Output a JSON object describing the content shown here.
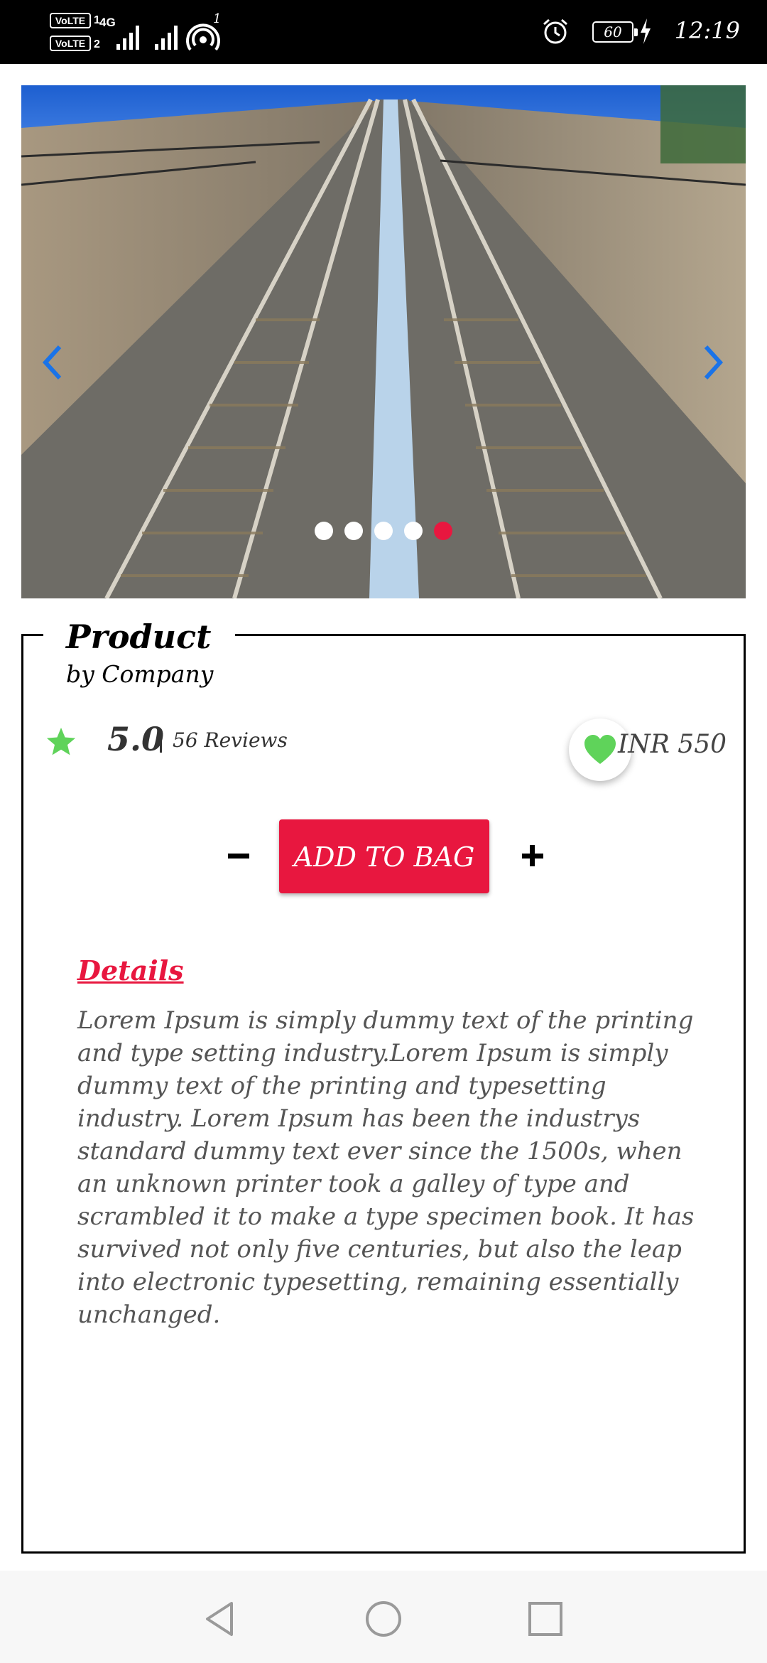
{
  "status_bar": {
    "sim1_label": "VoLTE",
    "sim1_num": "1",
    "network_type": "4G",
    "sim2_label": "VoLTE",
    "sim2_num": "2",
    "hotspot_count": "1",
    "battery_level": "60",
    "time": "12:19"
  },
  "carousel": {
    "total_slides": 5,
    "active_index": 4,
    "colors": {
      "active_dot": "#e8173f",
      "inactive_dot": "#ffffff",
      "arrow": "#1a73e8"
    }
  },
  "product": {
    "title": "Product",
    "company": "by Company",
    "rating": "5.0",
    "reviews": "56 Reviews",
    "price": "INR 550",
    "favorite": true
  },
  "cart": {
    "decrement_label": "−",
    "add_label": "ADD TO BAG",
    "increment_label": "+"
  },
  "details": {
    "heading": "Details",
    "text": " Lorem Ipsum is simply dummy text of the printing and type setting industry.Lorem Ipsum is simply dummy text of the printing and typesetting industry. Lorem Ipsum has been the industrys standard dummy text ever since the 1500s, when an unknown printer took a galley of type and scrambled it to make a type specimen book. It has survived not only five centuries, but also the leap into electronic typesetting, remaining essentially unchanged."
  },
  "theme": {
    "accent": "#e8173f",
    "star_color": "#5fd35a",
    "heart_color": "#5fd35a"
  }
}
